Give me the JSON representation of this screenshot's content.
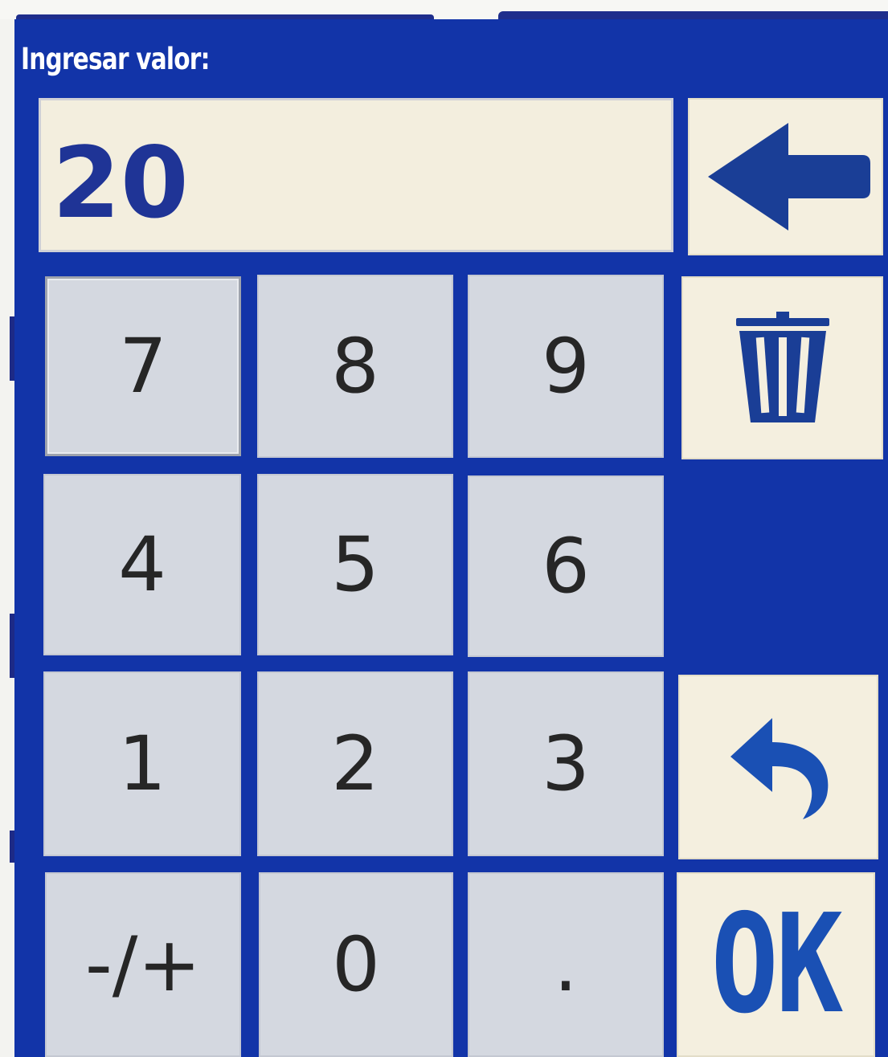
{
  "dialog": {
    "title": "Ingresar valor:",
    "value": "20"
  },
  "keypad": {
    "row1": [
      "7",
      "8",
      "9"
    ],
    "row2": [
      "4",
      "5",
      "6"
    ],
    "row3": [
      "1",
      "2",
      "3"
    ],
    "row4": [
      "-/+",
      "0",
      "."
    ]
  },
  "actions": {
    "backspace_icon": "arrow-left-icon",
    "clear_icon": "trash-icon",
    "undo_icon": "undo-arrow-icon",
    "ok_label": "OK"
  },
  "colors": {
    "panel": "#1234a8",
    "key": "#d4d8e0",
    "cream": "#f4efdf",
    "accent": "#1a50b4"
  }
}
